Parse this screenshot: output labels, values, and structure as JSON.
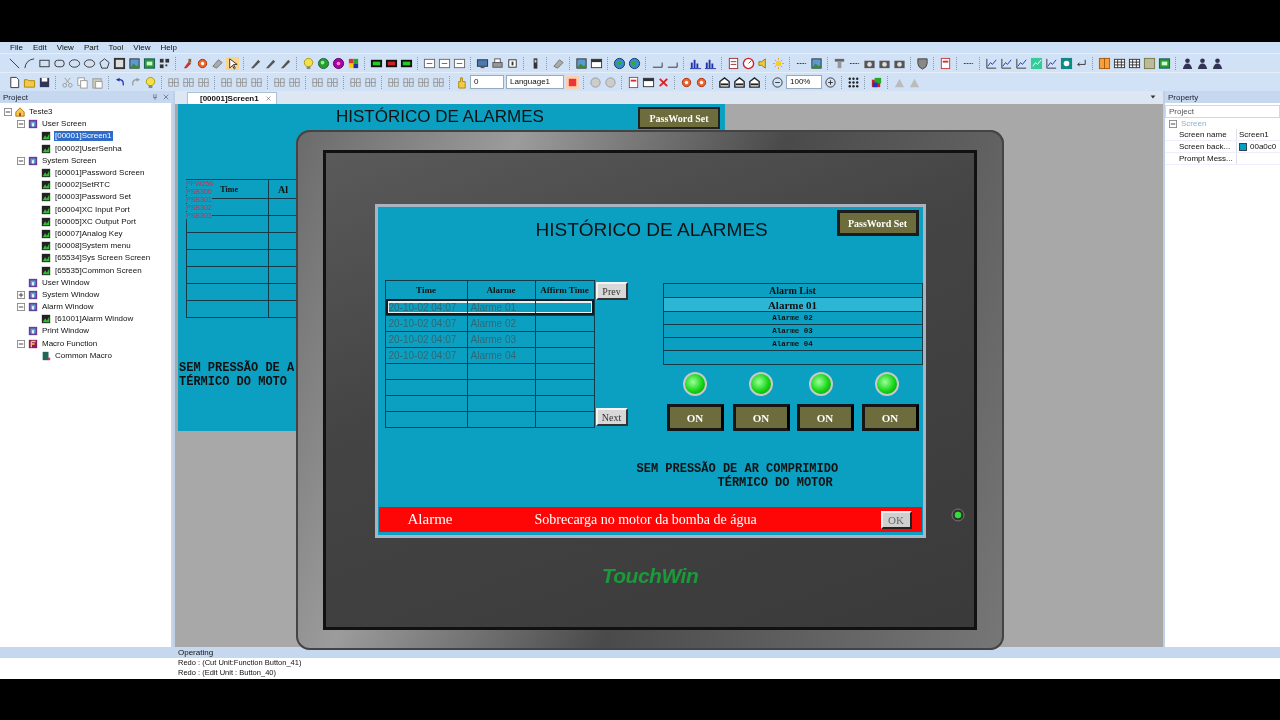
{
  "menu": [
    "File",
    "Edit",
    "View",
    "Part",
    "Tool",
    "View",
    "Help"
  ],
  "toolbar": {
    "page_spin": "0",
    "language": "Language1",
    "zoom": "100%"
  },
  "project_panel": {
    "title": "Project",
    "tree": [
      {
        "label": "Teste3",
        "kind": "project",
        "expanded": true,
        "selected": false,
        "children": [
          {
            "label": "User Screen",
            "kind": "group",
            "expanded": true,
            "selected": false,
            "children": [
              {
                "label": "[00001]Screen1",
                "kind": "screen",
                "selected": true
              },
              {
                "label": "[00002]UserSenha",
                "kind": "screen",
                "selected": false
              }
            ]
          },
          {
            "label": "System Screen",
            "kind": "group",
            "expanded": true,
            "selected": false,
            "children": [
              {
                "label": "[60001]Password Screen",
                "kind": "screen",
                "selected": false
              },
              {
                "label": "[60002]SetRTC",
                "kind": "screen",
                "selected": false
              },
              {
                "label": "[60003]Password Set",
                "kind": "screen",
                "selected": false
              },
              {
                "label": "[60004]XC Input Port",
                "kind": "screen",
                "selected": false
              },
              {
                "label": "[60005]XC Output Port",
                "kind": "screen",
                "selected": false
              },
              {
                "label": "[60007]Analog Key",
                "kind": "screen",
                "selected": false
              },
              {
                "label": "[60008]System menu",
                "kind": "screen",
                "selected": false
              },
              {
                "label": "[65534]Sys Screen Screen",
                "kind": "screen",
                "selected": false
              },
              {
                "label": "[65535]Common Screen",
                "kind": "screen",
                "selected": false
              }
            ]
          },
          {
            "label": "User Window",
            "kind": "group",
            "selected": false
          },
          {
            "label": "System Window",
            "kind": "group",
            "expanded": false,
            "selected": false
          },
          {
            "label": "Alarm Window",
            "kind": "group",
            "expanded": true,
            "selected": false,
            "children": [
              {
                "label": "[61001]Alarm Window",
                "kind": "screen",
                "selected": false
              }
            ]
          },
          {
            "label": "Print Window",
            "kind": "group",
            "selected": false
          },
          {
            "label": "Macro Function",
            "kind": "macro-group",
            "expanded": true,
            "selected": false,
            "children": [
              {
                "label": "Common Macro",
                "kind": "macro",
                "selected": false
              }
            ]
          }
        ]
      }
    ]
  },
  "editor": {
    "tab": {
      "label": "[00001]Screen1",
      "selected": true
    },
    "design_screen": {
      "title": "HISTÓRICO DE ALARMES",
      "password_button": "PassWord Set",
      "table_columns": [
        "Time",
        "Al"
      ],
      "tags": [
        "PFW256",
        "PSB300",
        "PSB301",
        "PSB302",
        "PSB303"
      ],
      "message_lines": [
        "SEM PRESSÃO DE A",
        "TÉRMICO DO MOTO"
      ]
    }
  },
  "simulator": {
    "title": "HISTÓRICO DE ALARMES",
    "password_button": "PassWord Set",
    "alarm_table": {
      "columns": [
        "Time",
        "Alarme",
        "Affirm Time"
      ],
      "rows": [
        {
          "time": "20-10-02 04:07",
          "alarm": "Alarme 01",
          "selected": true
        },
        {
          "time": "20-10-02 04:07",
          "alarm": "Alarme 02",
          "selected": false
        },
        {
          "time": "20-10-02 04:07",
          "alarm": "Alarme 03",
          "selected": false
        },
        {
          "time": "20-10-02 04:07",
          "alarm": "Alarme 04",
          "selected": false
        }
      ]
    },
    "prev_button": "Prev",
    "next_button": "Next",
    "alarm_list": {
      "title": "Alarm List",
      "items": [
        {
          "label": "Alarme 01",
          "selected": true
        },
        {
          "label": "Alarme 02",
          "selected": false
        },
        {
          "label": "Alarme 03",
          "selected": false
        },
        {
          "label": "Alarme 04",
          "selected": false
        }
      ]
    },
    "indicators": [
      {
        "lit": true,
        "button": "ON"
      },
      {
        "lit": true,
        "button": "ON"
      },
      {
        "lit": true,
        "button": "ON"
      },
      {
        "lit": true,
        "button": "ON"
      }
    ],
    "message_lines": [
      "SEM PRESSÃO DE AR COMPRIMIDO",
      "TÉRMICO DO MOTOR"
    ],
    "alarm_bar": {
      "label": "Alarme",
      "message": "Sobrecarga no motor da bomba de água",
      "ok_button": "OK"
    },
    "logo": "TouchWin"
  },
  "property_panel": {
    "title": "Property",
    "object": "Project",
    "group": {
      "label": "Screen",
      "expanded": true
    },
    "rows": [
      {
        "name": "Screen name",
        "value": "Screen1"
      },
      {
        "name": "Screen back...",
        "value": "00a0c0",
        "color": "#00a0c0"
      },
      {
        "name": "Prompt Mess..."
      }
    ]
  },
  "output_panel": {
    "title": "Operating",
    "lines": [
      "Redo : (Cut Unit:Function Button_41)",
      "Redo : (Edit Unit : Button_40)"
    ]
  }
}
